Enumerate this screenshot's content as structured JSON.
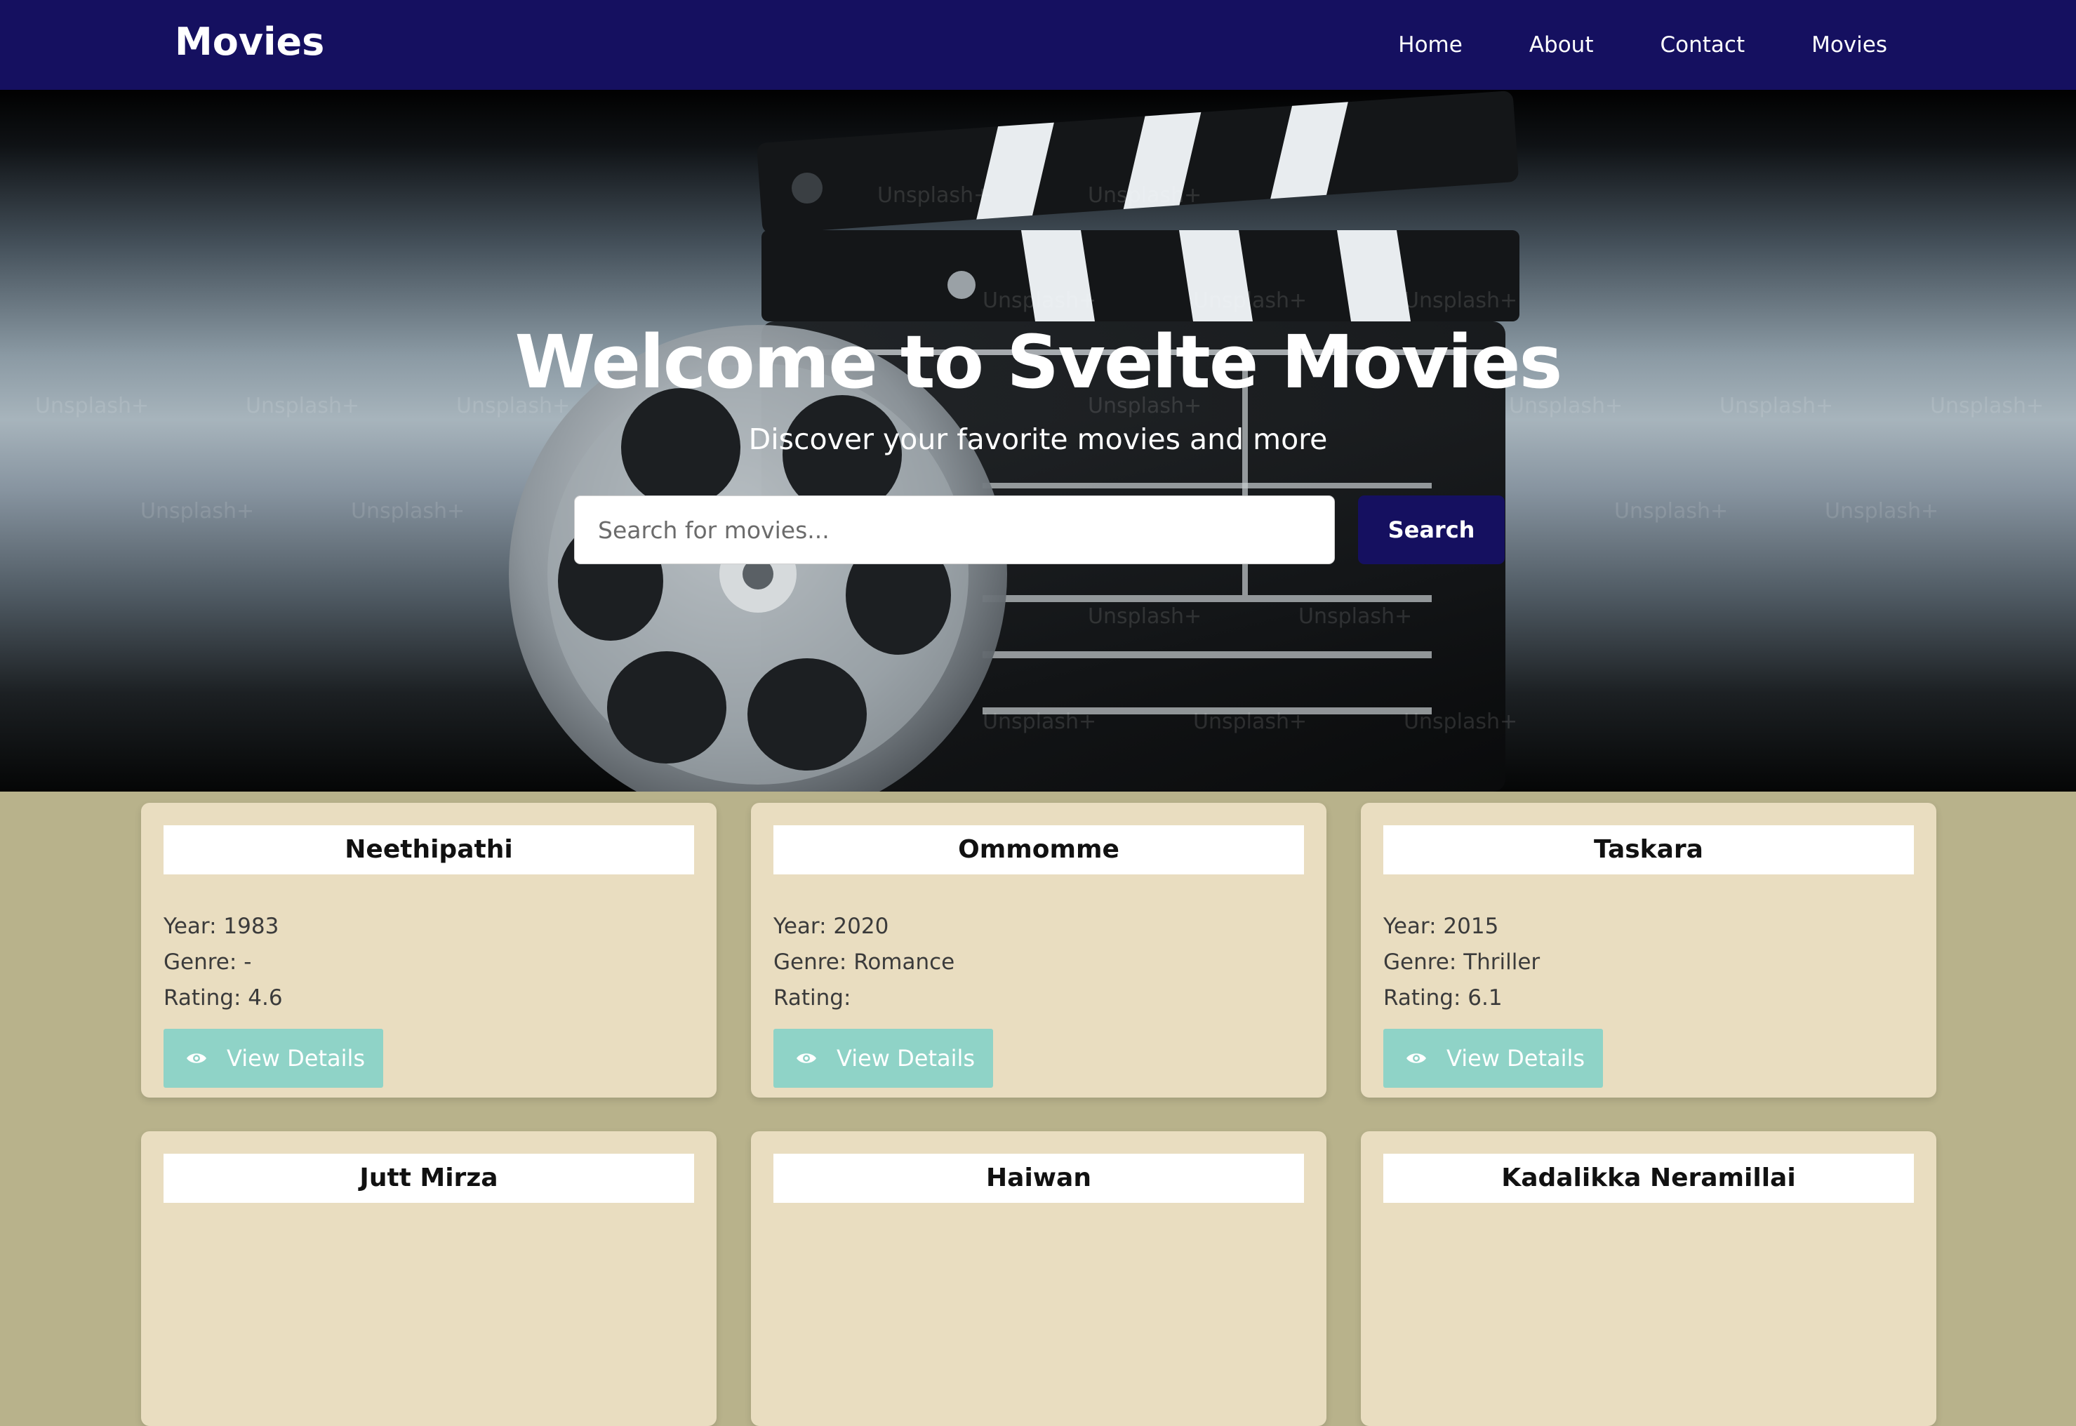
{
  "nav": {
    "brand": "Movies",
    "links": [
      "Home",
      "About",
      "Contact",
      "Movies"
    ],
    "bar_color": "#151060"
  },
  "hero": {
    "title": "Welcome to Svelte Movies",
    "subtitle": "Discover your favorite movies and more",
    "search_placeholder": "Search for movies...",
    "search_button": "Search",
    "watermark": "Unsplash+"
  },
  "cards": [
    {
      "title": "Neethipathi",
      "year_label": "Year:",
      "year": "1983",
      "genre_label": "Genre:",
      "genre": "-",
      "rating_label": "Rating:",
      "rating": "4.6",
      "button": "View Details"
    },
    {
      "title": "Ommomme",
      "year_label": "Year:",
      "year": "2020",
      "genre_label": "Genre:",
      "genre": "Romance",
      "rating_label": "Rating:",
      "rating": "",
      "button": "View Details"
    },
    {
      "title": "Taskara",
      "year_label": "Year:",
      "year": "2015",
      "genre_label": "Genre:",
      "genre": "Thriller",
      "rating_label": "Rating:",
      "rating": "6.1",
      "button": "View Details"
    },
    {
      "title": "Jutt Mirza"
    },
    {
      "title": "Haiwan"
    },
    {
      "title": "Kadalikka Neramillai"
    }
  ],
  "colors": {
    "page_bg": "#b8b28b",
    "card_bg": "#e9ddc0",
    "button_bg": "#8fd3c7",
    "accent": "#151060"
  }
}
